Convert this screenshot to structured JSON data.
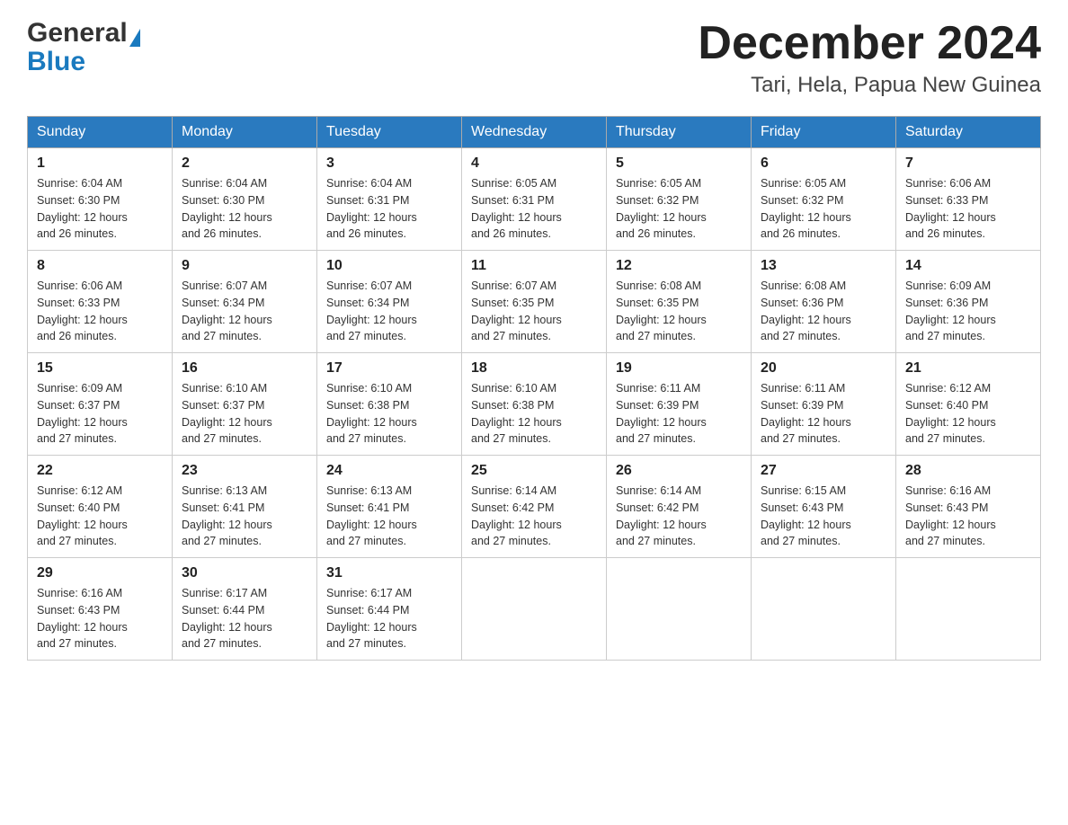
{
  "header": {
    "logo_general": "General",
    "logo_blue": "Blue",
    "month_year": "December 2024",
    "location": "Tari, Hela, Papua New Guinea"
  },
  "days_of_week": [
    "Sunday",
    "Monday",
    "Tuesday",
    "Wednesday",
    "Thursday",
    "Friday",
    "Saturday"
  ],
  "weeks": [
    [
      {
        "day": 1,
        "sunrise": "6:04 AM",
        "sunset": "6:30 PM",
        "daylight": "12 hours and 26 minutes."
      },
      {
        "day": 2,
        "sunrise": "6:04 AM",
        "sunset": "6:30 PM",
        "daylight": "12 hours and 26 minutes."
      },
      {
        "day": 3,
        "sunrise": "6:04 AM",
        "sunset": "6:31 PM",
        "daylight": "12 hours and 26 minutes."
      },
      {
        "day": 4,
        "sunrise": "6:05 AM",
        "sunset": "6:31 PM",
        "daylight": "12 hours and 26 minutes."
      },
      {
        "day": 5,
        "sunrise": "6:05 AM",
        "sunset": "6:32 PM",
        "daylight": "12 hours and 26 minutes."
      },
      {
        "day": 6,
        "sunrise": "6:05 AM",
        "sunset": "6:32 PM",
        "daylight": "12 hours and 26 minutes."
      },
      {
        "day": 7,
        "sunrise": "6:06 AM",
        "sunset": "6:33 PM",
        "daylight": "12 hours and 26 minutes."
      }
    ],
    [
      {
        "day": 8,
        "sunrise": "6:06 AM",
        "sunset": "6:33 PM",
        "daylight": "12 hours and 26 minutes."
      },
      {
        "day": 9,
        "sunrise": "6:07 AM",
        "sunset": "6:34 PM",
        "daylight": "12 hours and 27 minutes."
      },
      {
        "day": 10,
        "sunrise": "6:07 AM",
        "sunset": "6:34 PM",
        "daylight": "12 hours and 27 minutes."
      },
      {
        "day": 11,
        "sunrise": "6:07 AM",
        "sunset": "6:35 PM",
        "daylight": "12 hours and 27 minutes."
      },
      {
        "day": 12,
        "sunrise": "6:08 AM",
        "sunset": "6:35 PM",
        "daylight": "12 hours and 27 minutes."
      },
      {
        "day": 13,
        "sunrise": "6:08 AM",
        "sunset": "6:36 PM",
        "daylight": "12 hours and 27 minutes."
      },
      {
        "day": 14,
        "sunrise": "6:09 AM",
        "sunset": "6:36 PM",
        "daylight": "12 hours and 27 minutes."
      }
    ],
    [
      {
        "day": 15,
        "sunrise": "6:09 AM",
        "sunset": "6:37 PM",
        "daylight": "12 hours and 27 minutes."
      },
      {
        "day": 16,
        "sunrise": "6:10 AM",
        "sunset": "6:37 PM",
        "daylight": "12 hours and 27 minutes."
      },
      {
        "day": 17,
        "sunrise": "6:10 AM",
        "sunset": "6:38 PM",
        "daylight": "12 hours and 27 minutes."
      },
      {
        "day": 18,
        "sunrise": "6:10 AM",
        "sunset": "6:38 PM",
        "daylight": "12 hours and 27 minutes."
      },
      {
        "day": 19,
        "sunrise": "6:11 AM",
        "sunset": "6:39 PM",
        "daylight": "12 hours and 27 minutes."
      },
      {
        "day": 20,
        "sunrise": "6:11 AM",
        "sunset": "6:39 PM",
        "daylight": "12 hours and 27 minutes."
      },
      {
        "day": 21,
        "sunrise": "6:12 AM",
        "sunset": "6:40 PM",
        "daylight": "12 hours and 27 minutes."
      }
    ],
    [
      {
        "day": 22,
        "sunrise": "6:12 AM",
        "sunset": "6:40 PM",
        "daylight": "12 hours and 27 minutes."
      },
      {
        "day": 23,
        "sunrise": "6:13 AM",
        "sunset": "6:41 PM",
        "daylight": "12 hours and 27 minutes."
      },
      {
        "day": 24,
        "sunrise": "6:13 AM",
        "sunset": "6:41 PM",
        "daylight": "12 hours and 27 minutes."
      },
      {
        "day": 25,
        "sunrise": "6:14 AM",
        "sunset": "6:42 PM",
        "daylight": "12 hours and 27 minutes."
      },
      {
        "day": 26,
        "sunrise": "6:14 AM",
        "sunset": "6:42 PM",
        "daylight": "12 hours and 27 minutes."
      },
      {
        "day": 27,
        "sunrise": "6:15 AM",
        "sunset": "6:43 PM",
        "daylight": "12 hours and 27 minutes."
      },
      {
        "day": 28,
        "sunrise": "6:16 AM",
        "sunset": "6:43 PM",
        "daylight": "12 hours and 27 minutes."
      }
    ],
    [
      {
        "day": 29,
        "sunrise": "6:16 AM",
        "sunset": "6:43 PM",
        "daylight": "12 hours and 27 minutes."
      },
      {
        "day": 30,
        "sunrise": "6:17 AM",
        "sunset": "6:44 PM",
        "daylight": "12 hours and 27 minutes."
      },
      {
        "day": 31,
        "sunrise": "6:17 AM",
        "sunset": "6:44 PM",
        "daylight": "12 hours and 27 minutes."
      },
      null,
      null,
      null,
      null
    ]
  ]
}
